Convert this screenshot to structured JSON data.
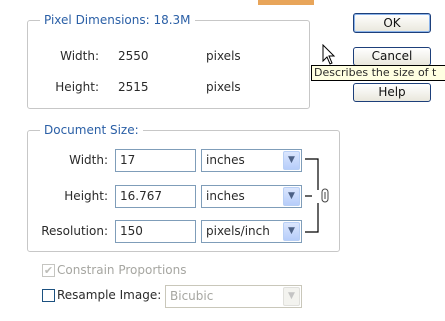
{
  "pixel_dimensions": {
    "legend": "Pixel Dimensions: 18.3M",
    "width_label": "Width:",
    "width_value": "2550",
    "width_unit": "pixels",
    "height_label": "Height:",
    "height_value": "2515",
    "height_unit": "pixels"
  },
  "document_size": {
    "legend": "Document Size:",
    "width_label": "Width:",
    "width_value": "17",
    "width_unit": "inches",
    "height_label": "Height:",
    "height_value": "16.767",
    "height_unit": "inches",
    "resolution_label": "Resolution:",
    "resolution_value": "150",
    "resolution_unit": "pixels/inch"
  },
  "buttons": {
    "ok": "OK",
    "cancel": "Cancel",
    "help": "Help"
  },
  "tooltip": "Describes the size of t",
  "options": {
    "constrain_label": "Constrain Proportions",
    "constrain_checked": true,
    "resample_label": "Resample Image:",
    "resample_checked": false,
    "resample_method": "Bicubic"
  },
  "colors": {
    "legend_text": "#2a5fa6",
    "tooltip_bg": "#ffffe1",
    "button_border": "#1d3f7a"
  }
}
